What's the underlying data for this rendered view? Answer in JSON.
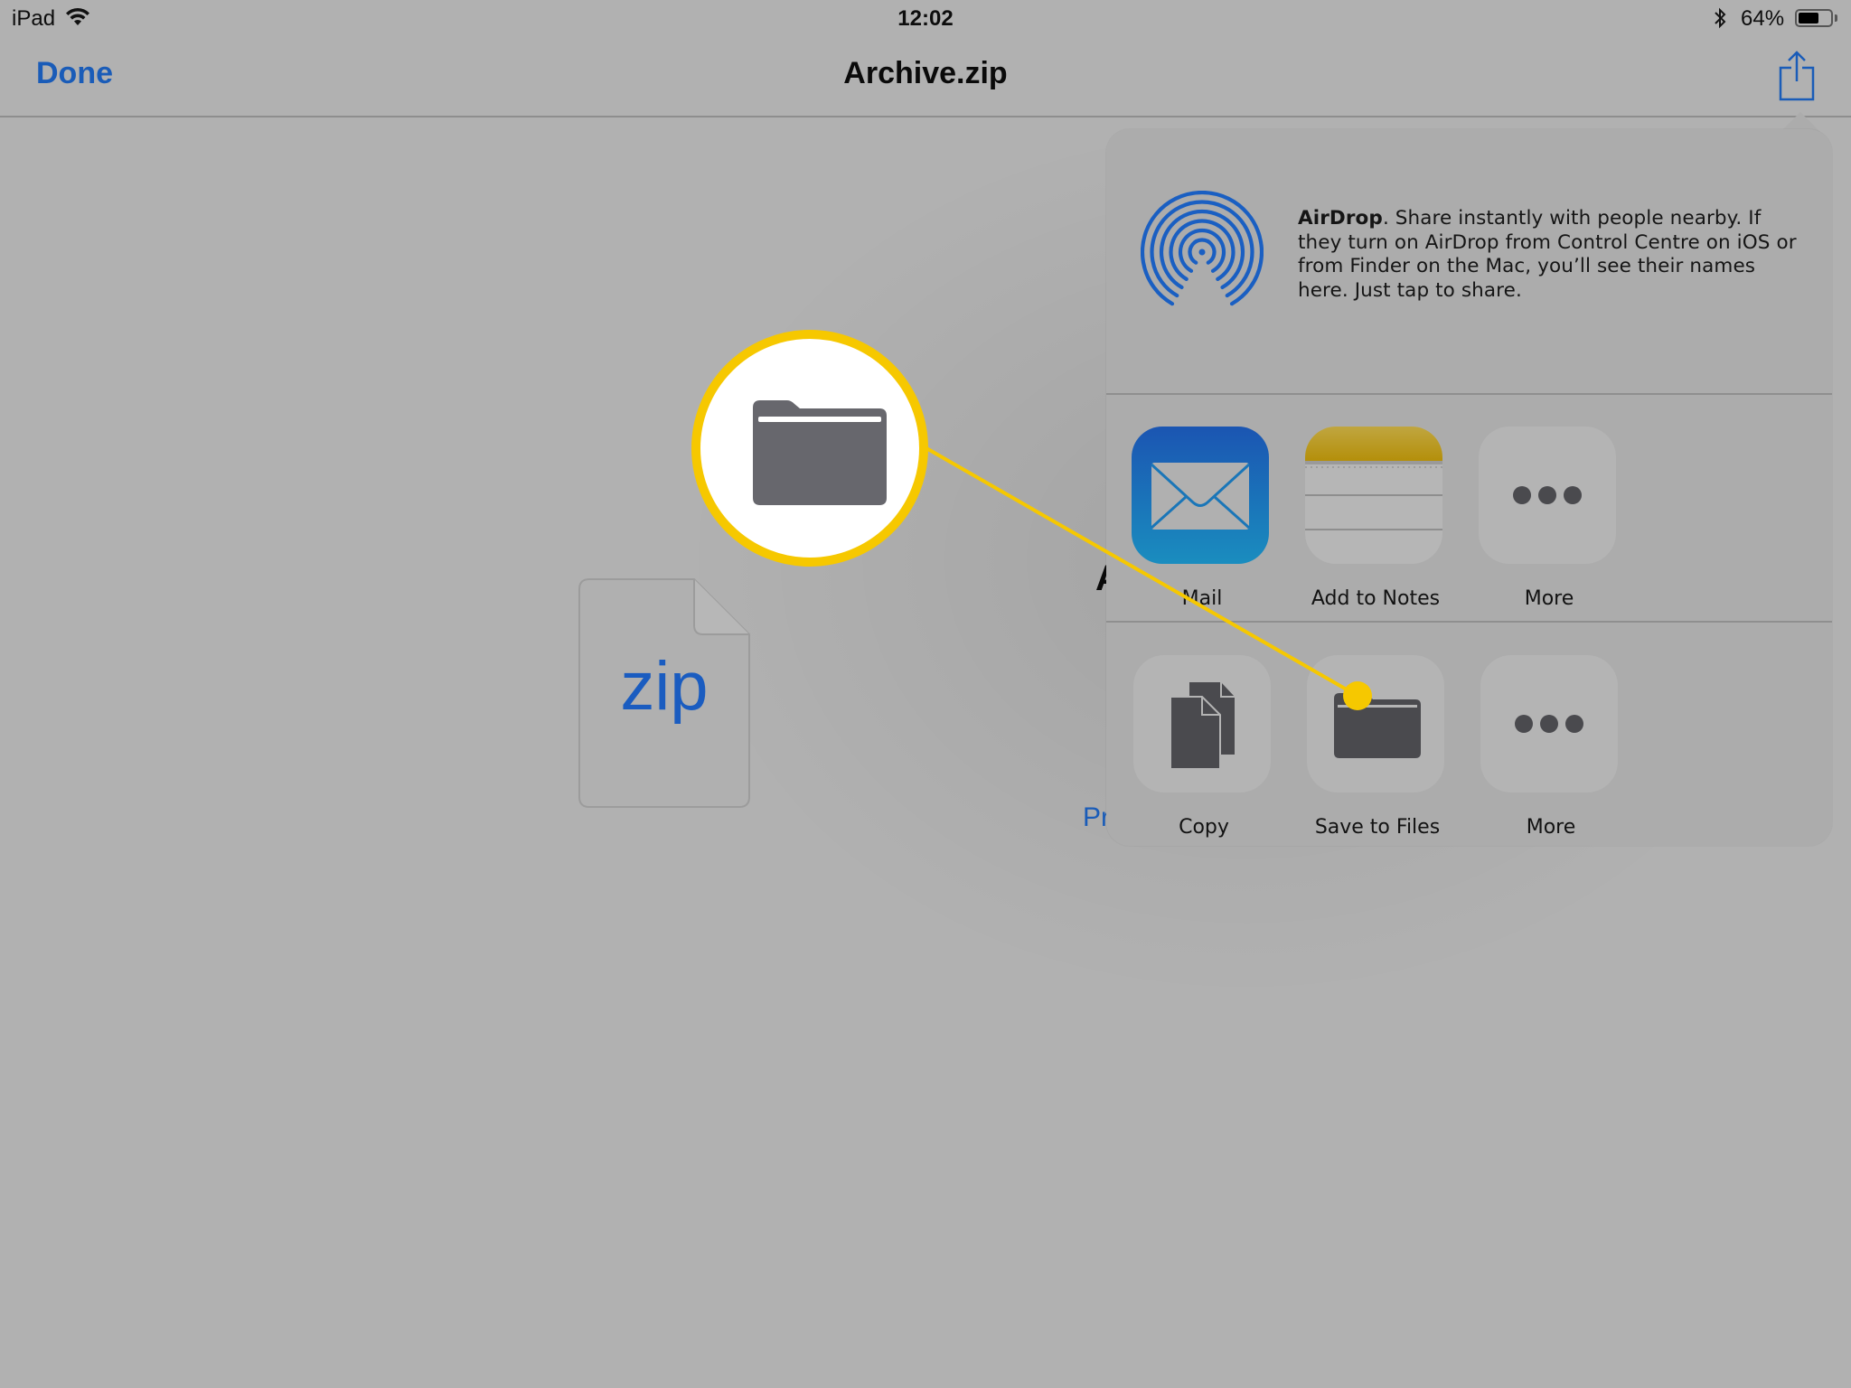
{
  "status_bar": {
    "device": "iPad",
    "time": "12:02",
    "battery_percent": "64%",
    "battery_level": 0.64,
    "icons": [
      "wifi-icon",
      "bluetooth-icon",
      "battery-icon"
    ]
  },
  "nav_bar": {
    "done_label": "Done",
    "title": "Archive.zip",
    "share_icon": "share-icon"
  },
  "document": {
    "file_type_label": "zip",
    "partially_hidden_title_letter": "A",
    "partially_hidden_link": "Pr"
  },
  "share_sheet": {
    "airdrop": {
      "title": "AirDrop",
      "description": ". Share instantly with people nearby. If they turn on AirDrop from Control Centre on iOS or from Finder on the Mac, you’ll see their names here. Just tap to share."
    },
    "app_row": [
      {
        "label": "Mail",
        "icon": "mail-icon"
      },
      {
        "label": "Add to Notes",
        "icon": "notes-icon"
      },
      {
        "label": "More",
        "icon": "more-icon"
      }
    ],
    "action_row": [
      {
        "label": "Copy",
        "icon": "copy-icon"
      },
      {
        "label": "Save to Files",
        "icon": "folder-icon"
      },
      {
        "label": "More",
        "icon": "more-icon"
      }
    ]
  },
  "callout": {
    "highlighted_item": "Save to Files",
    "icon": "folder-icon",
    "color": "#f6c800"
  },
  "colors": {
    "accent_blue": "#1a5cb8",
    "highlight_yellow": "#f6c800",
    "icon_gray": "#4a4a4e"
  }
}
